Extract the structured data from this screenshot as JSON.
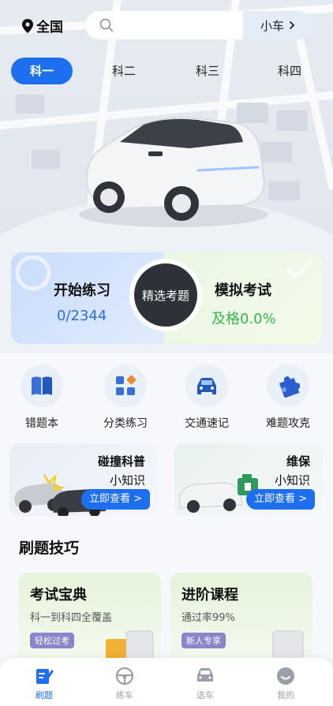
{
  "header": {
    "region": "全国",
    "search_placeholder": "",
    "car_type": "小车"
  },
  "subject_tabs": [
    {
      "label": "科一",
      "active": true
    },
    {
      "label": "科二",
      "active": false
    },
    {
      "label": "科三",
      "active": false
    },
    {
      "label": "科四",
      "active": false
    }
  ],
  "practice": {
    "left_title": "开始练习",
    "left_value": "0/2344",
    "center_label": "精选考题",
    "right_title": "模拟考试",
    "right_value": "及格0.0%"
  },
  "tools": [
    {
      "label": "错题本",
      "icon": "book-icon"
    },
    {
      "label": "分类练习",
      "icon": "category-icon"
    },
    {
      "label": "交通速记",
      "icon": "car-front-icon"
    },
    {
      "label": "难题攻克",
      "icon": "puzzle-icon"
    }
  ],
  "info_cards": [
    {
      "title": "碰撞科普",
      "sub": "小知识",
      "button": "立即查看 >"
    },
    {
      "title": "维保",
      "sub": "小知识",
      "button": "立即查看 >"
    }
  ],
  "tips_section": {
    "title": "刷题技巧"
  },
  "courses": [
    {
      "title": "考试宝典",
      "sub": "科一到科四全覆盖",
      "tag": "轻松过考"
    },
    {
      "title": "进阶课程",
      "sub": "通过率99%",
      "tag": "新人专享"
    }
  ],
  "bottom_nav": [
    {
      "label": "刷题",
      "active": true
    },
    {
      "label": "练车",
      "active": false
    },
    {
      "label": "选车",
      "active": false
    },
    {
      "label": "我的",
      "active": false
    }
  ],
  "colors": {
    "accent": "#1e6ef0",
    "pass_green": "#3bb54a",
    "progress_blue": "#2a6fdb"
  }
}
